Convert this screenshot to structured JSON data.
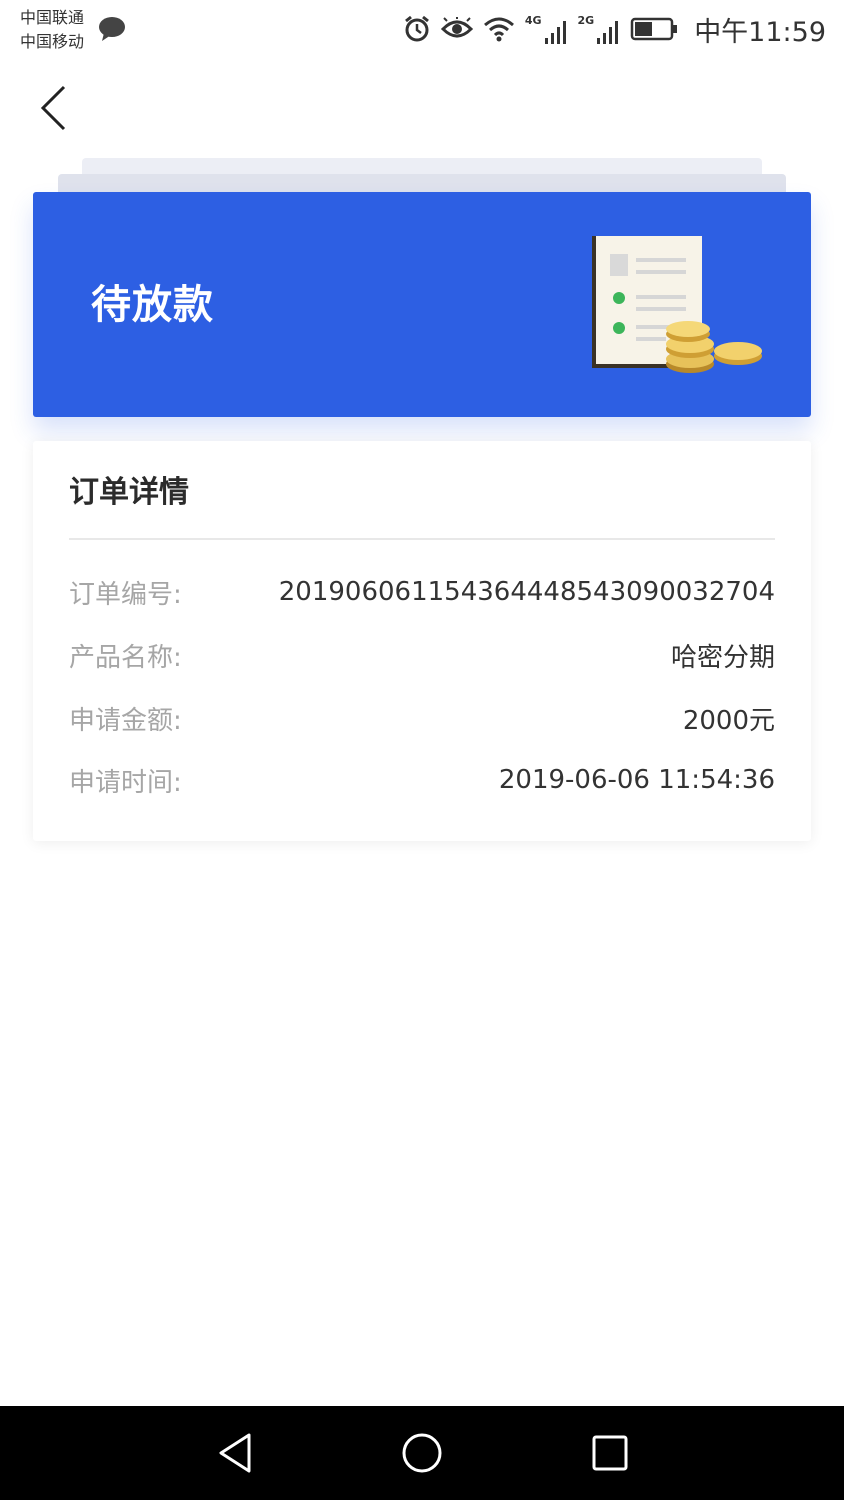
{
  "status_bar": {
    "carrier_1": "中国联通",
    "carrier_2": "中国移动",
    "net_1": "4G",
    "net_2": "2G",
    "time": "中午11:59",
    "icons": [
      "message-icon",
      "alarm-icon",
      "eye-icon",
      "wifi-icon",
      "signal-icon",
      "signal-icon",
      "battery-icon"
    ]
  },
  "header": {
    "back_icon": "chevron-left-icon"
  },
  "status_card": {
    "title": "待放款",
    "illustration": "document-with-coins",
    "color": "#2d5fe3"
  },
  "order_detail": {
    "title": "订单详情",
    "rows": [
      {
        "label": "订单编号:",
        "value": "20190606115436444854309003270​4"
      },
      {
        "label": "产品名称:",
        "value": "哈密分期"
      },
      {
        "label": "申请金额:",
        "value": "2000元"
      },
      {
        "label": "申请时间:",
        "value": "2019-06-06 11:54:36"
      }
    ]
  },
  "nav_bar": {
    "icons": [
      "back-triangle-icon",
      "home-circle-icon",
      "recents-square-icon"
    ]
  }
}
